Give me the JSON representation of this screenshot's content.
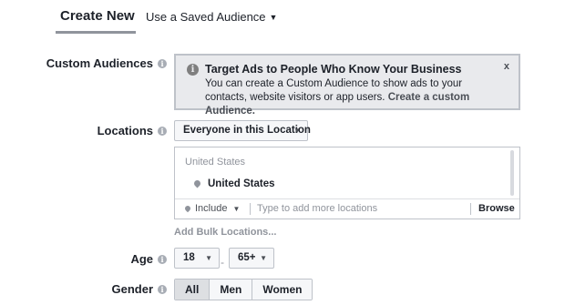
{
  "tabs": {
    "create_new": "Create New",
    "saved_audience": "Use a Saved Audience",
    "caret": "▼"
  },
  "custom_audiences": {
    "label": "Custom Audiences",
    "notice_title": "Target Ads to People Who Know Your Business",
    "notice_body": "You can create a Custom Audience to show ads to your contacts, website visitors or app users.",
    "notice_link": "Create a custom Audience.",
    "close": "x",
    "info_icon": "i"
  },
  "locations": {
    "label": "Locations",
    "dropdown_value": "Everyone in this Location",
    "country_header": "United States",
    "selected_items": [
      "United States"
    ],
    "include_label": "Include",
    "input_placeholder": "Type to add more locations",
    "input_value": "",
    "browse_label": "Browse",
    "bulk_link": "Add Bulk Locations..."
  },
  "age": {
    "label": "Age",
    "min": "18",
    "max": "65+",
    "separator": "-"
  },
  "gender": {
    "label": "Gender",
    "options": [
      "All",
      "Men",
      "Women"
    ],
    "selected": "All"
  }
}
